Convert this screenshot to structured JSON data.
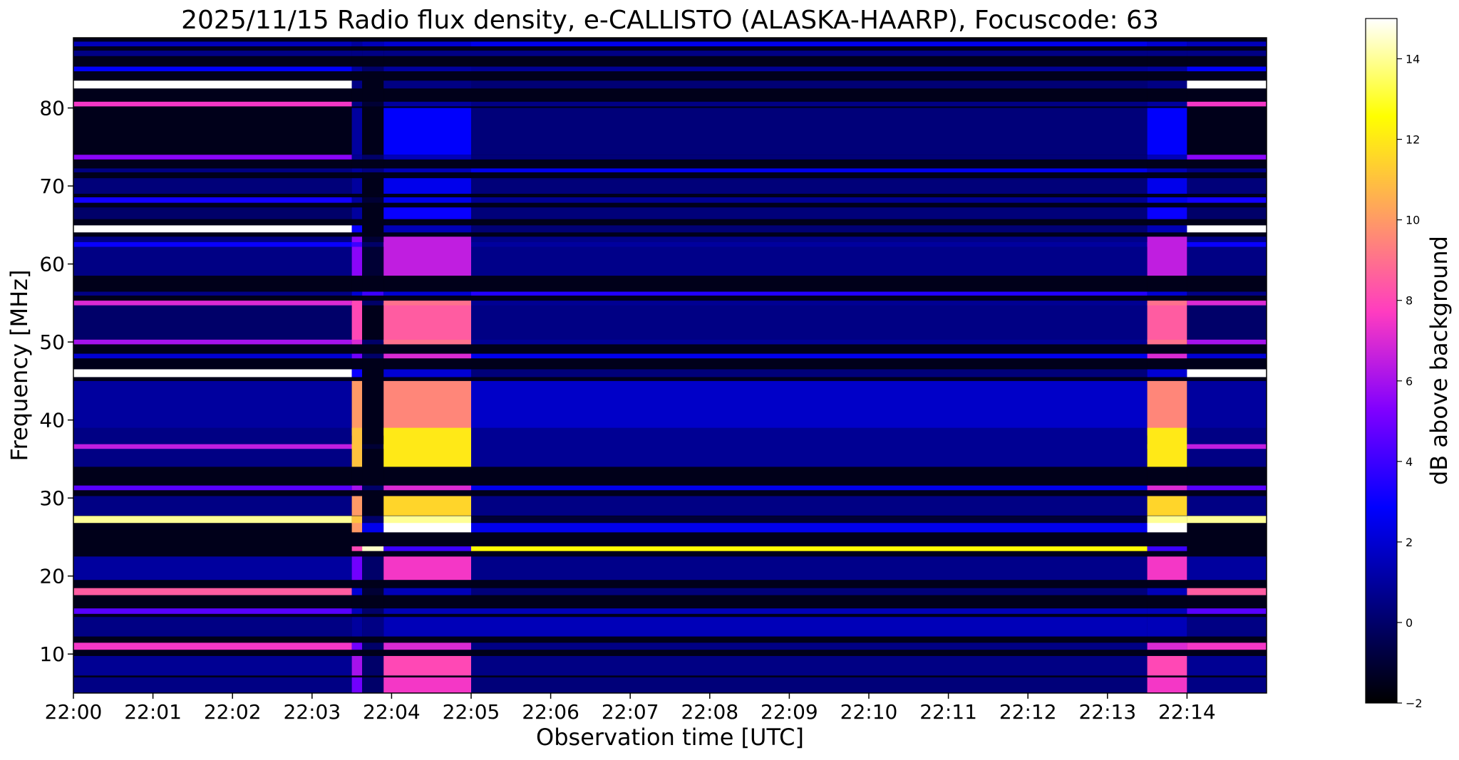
{
  "chart_data": {
    "type": "heatmap",
    "title": "2025/11/15  Radio flux density, e-CALLISTO (ALASKA-HAARP), Focuscode: 63",
    "xlabel": "Observation time [UTC]",
    "ylabel": "Frequency [MHz]",
    "colorbar_label": "dB above background",
    "x_ticks": [
      "22:00",
      "22:01",
      "22:02",
      "22:03",
      "22:04",
      "22:05",
      "22:06",
      "22:07",
      "22:08",
      "22:09",
      "22:10",
      "22:11",
      "22:12",
      "22:13",
      "22:14"
    ],
    "y_ticks": [
      10,
      20,
      30,
      40,
      50,
      60,
      70,
      80
    ],
    "colorbar_ticks": [
      -2,
      0,
      2,
      4,
      6,
      8,
      10,
      12,
      14
    ],
    "xlim_minutes": [
      0,
      15
    ],
    "ylim": [
      5,
      89
    ],
    "clim": [
      -2,
      15
    ],
    "colormap": "gnuplot2",
    "colormap_stops": [
      "#000000",
      "#000080",
      "#0000ff",
      "#8000ff",
      "#ff3cc0",
      "#ffa060",
      "#ffff00",
      "#ffffff"
    ],
    "grid": false,
    "base_level_db": -1.5,
    "time_segments": [
      {
        "name": "quiet",
        "start_min": 0.0,
        "end_min": 3.5
      },
      {
        "name": "transition",
        "start_min": 3.5,
        "end_min": 3.63
      },
      {
        "name": "dark",
        "start_min": 3.63,
        "end_min": 3.9
      },
      {
        "name": "burst",
        "start_min": 3.9,
        "end_min": 5.0
      },
      {
        "name": "mid",
        "start_min": 5.0,
        "end_min": 13.5
      },
      {
        "name": "burst",
        "start_min": 13.5,
        "end_min": 14.0
      },
      {
        "name": "quiet",
        "start_min": 14.0,
        "end_min": 15.0
      }
    ],
    "frequency_bands": [
      {
        "f_mhz": 88.2,
        "width_mhz": 0.6,
        "db": {
          "quiet": 1.5,
          "transition": 1.0,
          "dark": 1.5,
          "burst": 2.0,
          "mid": 2.5
        }
      },
      {
        "f_mhz": 87.0,
        "width_mhz": 0.7,
        "db": {
          "quiet": 0.5,
          "transition": 0.5,
          "dark": 0.5,
          "burst": 0.5,
          "mid": 0.5
        }
      },
      {
        "f_mhz": 85.0,
        "width_mhz": 0.6,
        "db": {
          "quiet": 2.8,
          "transition": 1.0,
          "dark": 0.0,
          "burst": 1.0,
          "mid": 0.8
        }
      },
      {
        "f_mhz": 83.0,
        "width_mhz": 1.0,
        "db": {
          "quiet": 15.0,
          "transition": 0.5,
          "dark": -1.5,
          "burst": 0.5,
          "mid": 0.2
        }
      },
      {
        "f_mhz": 80.5,
        "width_mhz": 0.6,
        "db": {
          "quiet": 7.5,
          "transition": 0.5,
          "dark": -1.0,
          "burst": 1.0,
          "mid": 0.5
        }
      },
      {
        "f_mhz": 77.0,
        "width_mhz": 6.0,
        "db": {
          "quiet": -1.5,
          "transition": 1.0,
          "dark": -1.5,
          "burst": 2.8,
          "mid": 0.3
        }
      },
      {
        "f_mhz": 73.7,
        "width_mhz": 0.6,
        "db": {
          "quiet": 5.5,
          "transition": 0.8,
          "dark": 0.0,
          "burst": 1.5,
          "mid": 0.3
        }
      },
      {
        "f_mhz": 72.0,
        "width_mhz": 0.5,
        "db": {
          "quiet": 0.5,
          "transition": 1.0,
          "dark": 0.5,
          "burst": 1.5,
          "mid": 2.5
        }
      },
      {
        "f_mhz": 70.0,
        "width_mhz": 2.0,
        "db": {
          "quiet": 0.3,
          "transition": 1.0,
          "dark": -1.5,
          "burst": 2.5,
          "mid": 0.3
        }
      },
      {
        "f_mhz": 68.2,
        "width_mhz": 0.7,
        "db": {
          "quiet": 3.2,
          "transition": 1.0,
          "dark": -1.0,
          "burst": 2.5,
          "mid": 0.8
        }
      },
      {
        "f_mhz": 66.5,
        "width_mhz": 1.5,
        "db": {
          "quiet": 0.0,
          "transition": 1.0,
          "dark": -1.5,
          "burst": 3.0,
          "mid": 0.3
        }
      },
      {
        "f_mhz": 64.5,
        "width_mhz": 0.9,
        "db": {
          "quiet": 15.0,
          "transition": 3.0,
          "dark": -1.5,
          "burst": 1.5,
          "mid": 0.2
        }
      },
      {
        "f_mhz": 61.0,
        "width_mhz": 5.0,
        "db": {
          "quiet": 0.5,
          "transition": 5.5,
          "dark": -1.0,
          "burst": 6.5,
          "mid": 0.6
        }
      },
      {
        "f_mhz": 62.5,
        "width_mhz": 0.6,
        "db": {
          "quiet": 3.0,
          "transition": 4.0,
          "dark": 0.0,
          "burst": 6.5,
          "mid": 1.0
        }
      },
      {
        "f_mhz": 56.2,
        "width_mhz": 0.5,
        "db": {
          "quiet": 0.5,
          "transition": 2.0,
          "dark": 4.0,
          "burst": 2.0,
          "mid": 3.5
        }
      },
      {
        "f_mhz": 52.5,
        "width_mhz": 5.0,
        "db": {
          "quiet": 0.0,
          "transition": 8.0,
          "dark": -1.5,
          "burst": 8.5,
          "mid": 0.5
        }
      },
      {
        "f_mhz": 55.0,
        "width_mhz": 0.6,
        "db": {
          "quiet": 7.0,
          "transition": 8.0,
          "dark": 0.0,
          "burst": 9.0,
          "mid": 0.8
        }
      },
      {
        "f_mhz": 50.0,
        "width_mhz": 0.6,
        "db": {
          "quiet": 6.0,
          "transition": 7.0,
          "dark": 0.0,
          "burst": 9.0,
          "mid": 0.8
        }
      },
      {
        "f_mhz": 48.2,
        "width_mhz": 0.6,
        "db": {
          "quiet": 2.0,
          "transition": 5.0,
          "dark": 0.0,
          "burst": 7.0,
          "mid": 2.5
        }
      },
      {
        "f_mhz": 46.0,
        "width_mhz": 1.0,
        "db": {
          "quiet": 15.0,
          "transition": 3.0,
          "dark": -1.5,
          "burst": 2.0,
          "mid": 0.3
        }
      },
      {
        "f_mhz": 41.5,
        "width_mhz": 7.0,
        "db": {
          "quiet": 1.0,
          "transition": 10.0,
          "dark": -1.5,
          "burst": 9.5,
          "mid": 1.8
        }
      },
      {
        "f_mhz": 36.5,
        "width_mhz": 5.0,
        "db": {
          "quiet": 0.5,
          "transition": 11.0,
          "dark": -1.5,
          "burst": 12.0,
          "mid": 0.8
        }
      },
      {
        "f_mhz": 36.6,
        "width_mhz": 0.6,
        "db": {
          "quiet": 6.5,
          "transition": 11.0,
          "dark": -1.0,
          "burst": 12.0,
          "mid": 0.8
        }
      },
      {
        "f_mhz": 31.3,
        "width_mhz": 0.6,
        "db": {
          "quiet": 4.5,
          "transition": 6.0,
          "dark": 0.0,
          "burst": 7.0,
          "mid": 2.5
        }
      },
      {
        "f_mhz": 29.0,
        "width_mhz": 2.5,
        "db": {
          "quiet": 0.5,
          "transition": 10.0,
          "dark": -1.5,
          "burst": 11.5,
          "mid": 0.5
        }
      },
      {
        "f_mhz": 27.2,
        "width_mhz": 1.0,
        "db": {
          "quiet": 14.0,
          "transition": 11.0,
          "dark": 0.0,
          "burst": 14.0,
          "mid": -1.0
        }
      },
      {
        "f_mhz": 26.2,
        "width_mhz": 1.2,
        "db": {
          "quiet": -1.5,
          "transition": 10.0,
          "dark": 2.5,
          "burst": 15.0,
          "mid": 2.5
        }
      },
      {
        "f_mhz": 23.5,
        "width_mhz": 0.6,
        "db": {
          "quiet": -1.5,
          "transition": 8.0,
          "dark": 14.5,
          "burst": 4.0,
          "mid": 12.5
        }
      },
      {
        "f_mhz": 21.0,
        "width_mhz": 3.0,
        "db": {
          "quiet": 1.0,
          "transition": 5.0,
          "dark": 0.0,
          "burst": 7.5,
          "mid": 0.6
        }
      },
      {
        "f_mhz": 18.0,
        "width_mhz": 0.9,
        "db": {
          "quiet": 8.5,
          "transition": 2.0,
          "dark": -1.0,
          "burst": 1.5,
          "mid": 0.3
        }
      },
      {
        "f_mhz": 15.5,
        "width_mhz": 0.7,
        "db": {
          "quiet": 4.5,
          "transition": 1.5,
          "dark": 0.0,
          "burst": 1.5,
          "mid": 1.5
        }
      },
      {
        "f_mhz": 13.5,
        "width_mhz": 2.5,
        "db": {
          "quiet": 0.5,
          "transition": 1.0,
          "dark": 0.5,
          "burst": 1.5,
          "mid": 1.5
        }
      },
      {
        "f_mhz": 11.0,
        "width_mhz": 0.9,
        "db": {
          "quiet": 7.5,
          "transition": 5.0,
          "dark": 0.0,
          "burst": 7.0,
          "mid": 0.5
        }
      },
      {
        "f_mhz": 8.5,
        "width_mhz": 2.5,
        "db": {
          "quiet": 0.8,
          "transition": 6.0,
          "dark": 0.0,
          "burst": 8.0,
          "mid": 0.5
        }
      },
      {
        "f_mhz": 6.0,
        "width_mhz": 2.0,
        "db": {
          "quiet": 0.5,
          "transition": 5.0,
          "dark": 0.0,
          "burst": 7.5,
          "mid": 0.3
        }
      }
    ]
  }
}
